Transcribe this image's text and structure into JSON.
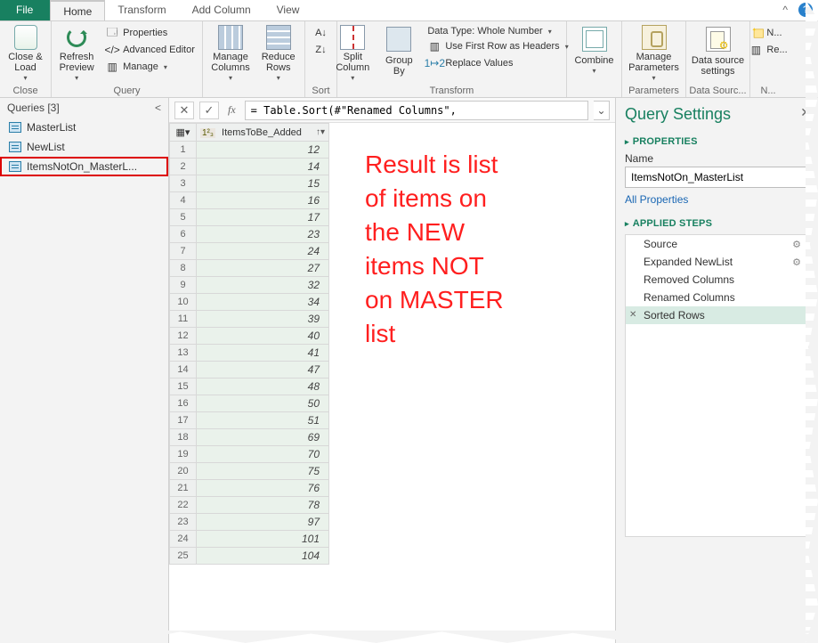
{
  "tabs": {
    "file": "File",
    "home": "Home",
    "transform": "Transform",
    "addcol": "Add Column",
    "view": "View"
  },
  "ribbon": {
    "close": {
      "label": "Close &\nLoad",
      "group": "Close"
    },
    "refresh": {
      "label": "Refresh\nPreview",
      "group_q": "Query",
      "props": "Properties",
      "adv": "Advanced Editor",
      "manage": "Manage"
    },
    "mcols": {
      "label": "Manage\nColumns"
    },
    "rrows": {
      "label": "Reduce\nRows"
    },
    "sort": {
      "group": "Sort"
    },
    "split": {
      "label": "Split\nColumn"
    },
    "group": {
      "label": "Group\nBy"
    },
    "transform_group": "Transform",
    "dtype": "Data Type: Whole Number",
    "firstrow": "Use First Row as Headers",
    "replace": "Replace Values",
    "combine": {
      "label": "Combine"
    },
    "params": {
      "label": "Manage\nParameters",
      "group": "Parameters"
    },
    "dsrc": {
      "label": "Data source\nsettings",
      "group": "Data Sourc..."
    },
    "newq": {
      "label1": "N...",
      "label2": "Re...",
      "group": "N..."
    }
  },
  "queries_pane": {
    "header": "Queries [3]",
    "items": [
      "MasterList",
      "NewList",
      "ItemsNotOn_MasterL..."
    ]
  },
  "fx": {
    "formula": "= Table.Sort(#\"Renamed Columns\",",
    "label": "fx"
  },
  "grid": {
    "col_type": "1²₃",
    "col_name": "ItemsToBe_Added",
    "rows": [
      12,
      14,
      15,
      16,
      17,
      23,
      24,
      27,
      32,
      34,
      39,
      40,
      41,
      47,
      48,
      50,
      51,
      69,
      70,
      75,
      76,
      78,
      97,
      101,
      104
    ]
  },
  "annotation": "Result is list\nof items on\nthe NEW\nitems NOT\non MASTER\nlist",
  "qs": {
    "title": "Query Settings",
    "props": "PROPERTIES",
    "name": "Name",
    "name_val": "ItemsNotOn_MasterList",
    "allprops": "All Properties",
    "applied": "APPLIED STEPS",
    "steps": [
      "Source",
      "Expanded NewList",
      "Removed Columns",
      "Renamed Columns",
      "Sorted Rows"
    ],
    "selected_step": 4,
    "gear_steps": [
      0,
      1
    ]
  }
}
